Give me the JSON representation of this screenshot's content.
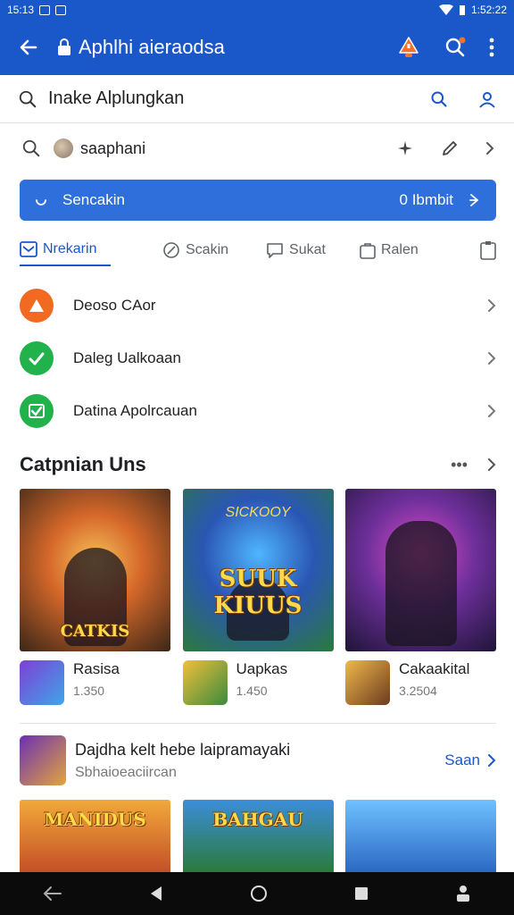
{
  "status_bar": {
    "time": "15:13",
    "clock_right": "1:52:22"
  },
  "app_bar": {
    "title": "Aphlhi aieraodsa"
  },
  "search": {
    "query": "Inake Alplungkan"
  },
  "user": {
    "name": "saaphani"
  },
  "banner": {
    "label": "Sencakin",
    "count": "0 Ibmbit"
  },
  "tabs": [
    {
      "label": "Nrekarin"
    },
    {
      "label": "Scakin"
    },
    {
      "label": "Sukat"
    },
    {
      "label": "Ralen"
    }
  ],
  "menu_items": [
    {
      "label": "Deoso CAor",
      "icon": "warning-icon",
      "color": "#f26a21"
    },
    {
      "label": "Daleg Ualkoaan",
      "icon": "check-icon",
      "color": "#22b24c"
    },
    {
      "label": "Datina Apolrcauan",
      "icon": "check-box-icon",
      "color": "#22b24c"
    }
  ],
  "section": {
    "title": "Catpnian Uns"
  },
  "games": [
    {
      "art_title": "CATKIS",
      "name": "Rasisa",
      "count": "1.350"
    },
    {
      "art_subtitle": "SICKOOY",
      "art_title": "SUUK KIUUS",
      "name": "Uapkas",
      "count": "1.450"
    },
    {
      "art_title": "",
      "name": "Cakaakital",
      "count": "3.2504"
    }
  ],
  "promo": {
    "title": "Dajdha kelt hebe laipramayaki",
    "subtitle": "Sbhaioeaciircan",
    "link": "Saan"
  },
  "bottom_games": [
    {
      "art_title": "MANIDUS"
    },
    {
      "art_title": "BAHGAU"
    },
    {
      "art_title": ""
    }
  ],
  "colors": {
    "primary": "#1a57c9",
    "banner": "#2f6fdc",
    "accent_orange": "#f26a21",
    "accent_green": "#22b24c"
  }
}
